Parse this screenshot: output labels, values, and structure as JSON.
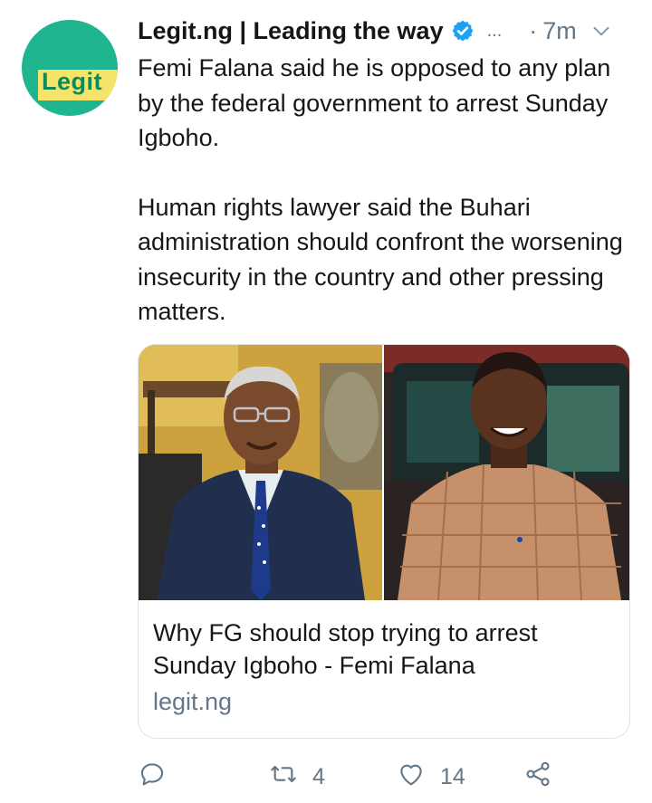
{
  "account": {
    "name": "Legit.ng | Leading the way",
    "avatar_logo_text": "Legit",
    "verified": true
  },
  "meta": {
    "more_indicator": "...",
    "separator": "·",
    "time": "7m"
  },
  "body": {
    "paragraph1": "Femi Falana said he is opposed to any plan by the federal government to arrest Sunday Igboho.",
    "paragraph2": "Human rights lawyer said the Buhari administration should confront the worsening insecurity in the country and other pressing matters."
  },
  "card": {
    "title": "Why FG should stop trying to arrest Sunday Igboho - Femi Falana",
    "domain": "legit.ng"
  },
  "actions": {
    "reply_count": "",
    "retweet_count": "4",
    "like_count": "14"
  },
  "colors": {
    "text": "#14171a",
    "secondary": "#657786",
    "verified": "#1da1f2",
    "border": "#dde3e8",
    "avatar_bg": "#1fb58f",
    "avatar_band": "#f6e36a"
  }
}
